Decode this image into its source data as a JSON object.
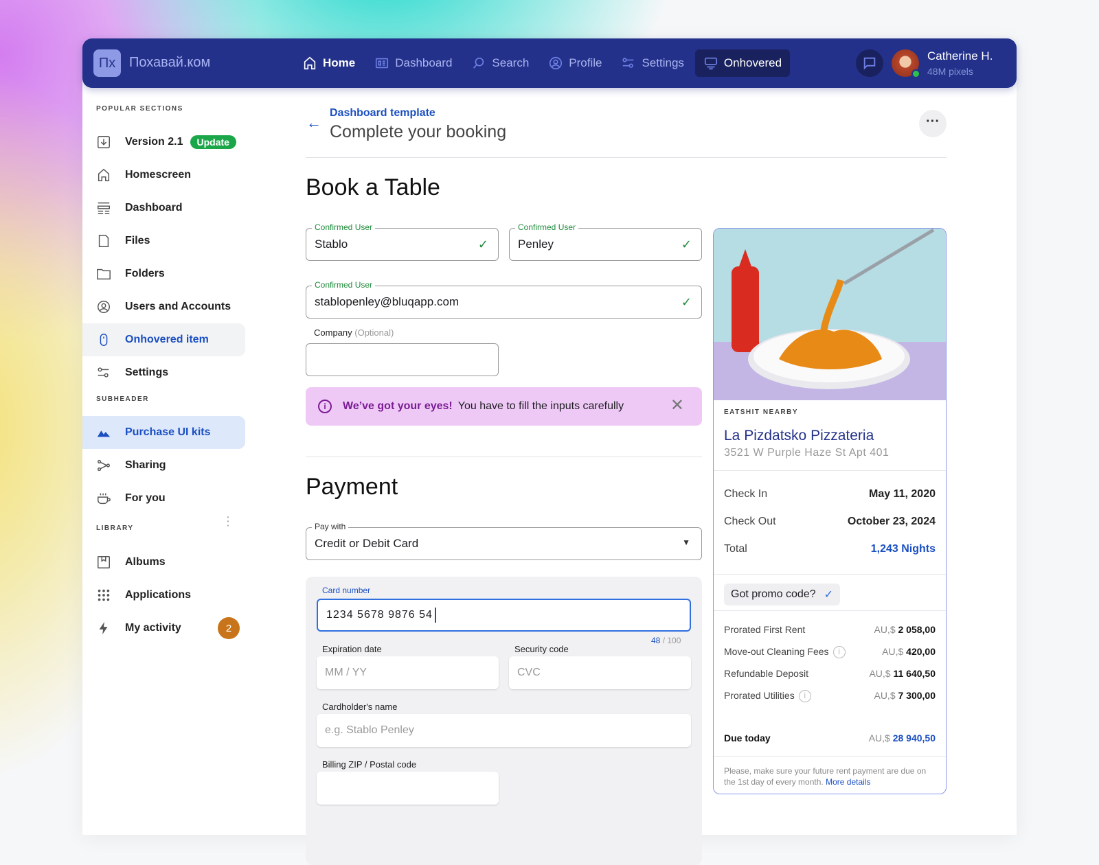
{
  "header": {
    "logo": "Пх",
    "brand": "Похавай.ком",
    "nav": [
      {
        "label": "Home",
        "icon": "home-icon"
      },
      {
        "label": "Dashboard",
        "icon": "dashboard-icon"
      },
      {
        "label": "Search",
        "icon": "search-icon"
      },
      {
        "label": "Profile",
        "icon": "profile-icon"
      },
      {
        "label": "Settings",
        "icon": "settings-icon"
      },
      {
        "label": "Onhovered",
        "icon": "monitor-icon"
      }
    ],
    "user": {
      "name": "Catherine H.",
      "subtitle": "48M pixels"
    }
  },
  "sidebar": {
    "popular_title": "POPULAR SECTIONS",
    "version": "Version 2.1",
    "update_badge": "Update",
    "popular": [
      "Homescreen",
      "Dashboard",
      "Files",
      "Folders",
      "Users and Accounts",
      "Onhovered item",
      "Settings"
    ],
    "subheader_title": "SUBHEADER",
    "subheader": [
      "Purchase UI kits",
      "Sharing",
      "For you"
    ],
    "library_title": "LIBRARY",
    "library": [
      "Albums",
      "Applications",
      "My activity"
    ],
    "activity_count": "2"
  },
  "main": {
    "breadcrumb": "Dashboard template",
    "title": "Complete your booking",
    "book_title": "Book a Table",
    "fields": {
      "first": {
        "label": "Confirmed User",
        "value": "Stablo"
      },
      "last": {
        "label": "Confirmed User",
        "value": "Penley"
      },
      "email": {
        "label": "Confirmed User",
        "value": "stablopenley@bluqapp.com"
      },
      "company_label": "Company",
      "company_optional": "(Optional)"
    },
    "alert": {
      "bold": "We’ve got your eyes!",
      "text": "You have to fill the inputs carefully"
    },
    "payment_title": "Payment",
    "pay_with": {
      "label": "Pay with",
      "value": "Credit or Debit Card"
    },
    "card_number": {
      "label": "Card number",
      "value": "1234  5678  9876  54",
      "counter_current": "48",
      "counter_max": " / 100"
    },
    "expiration": {
      "label": "Expiration date",
      "placeholder": "MM / YY"
    },
    "security": {
      "label": "Security code",
      "placeholder": "CVC"
    },
    "cardholder": {
      "label": "Cardholder's name",
      "placeholder": "e.g. Stablo Penley"
    },
    "zip": {
      "label": "Billing ZIP / Postal code",
      "placeholder": ""
    }
  },
  "booking": {
    "overline": "EATSHIT NEARBY",
    "name": "La Pizdatsko Pizzateria",
    "address": "3521 W Purple Haze St Apt 401",
    "check_in": {
      "label": "Check In",
      "value": "May 11, 2020"
    },
    "check_out": {
      "label": "Check Out",
      "value": "October 23, 2024"
    },
    "total": {
      "label": "Total",
      "value": "1,243 Nights"
    },
    "promo": "Got promo code?",
    "fees": [
      {
        "label": "Prorated First Rent",
        "currency": "AU,$",
        "amount": "2 058,00",
        "info": false
      },
      {
        "label": "Move-out Cleaning Fees",
        "currency": "AU,$",
        "amount": "420,00",
        "info": true
      },
      {
        "label": "Refundable Deposit",
        "currency": "AU,$",
        "amount": "11 640,50",
        "info": false
      },
      {
        "label": "Prorated Utilities",
        "currency": "AU,$",
        "amount": "7 300,00",
        "info": true
      }
    ],
    "due": {
      "label": "Due today",
      "currency": "AU,$",
      "amount": "28 940,50"
    },
    "note": "Please, make sure your future rent payment are due on the 1st day of every month.",
    "note_link": "More details"
  }
}
